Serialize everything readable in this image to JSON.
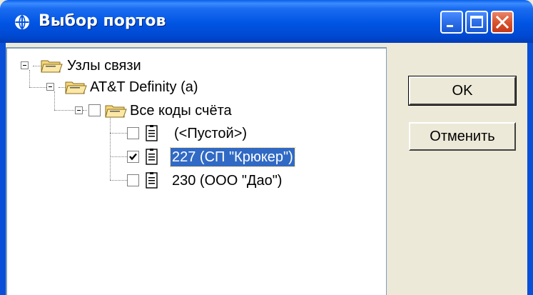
{
  "window": {
    "title": "Выбор портов"
  },
  "tree": {
    "root": {
      "label": "Узлы связи",
      "icon": "folder-open-icon",
      "expanded": true,
      "child": {
        "label": "AT&T Definity (a)",
        "icon": "folder-open-icon",
        "expanded": true,
        "child": {
          "label": "Все коды счёта",
          "icon": "folder-open-icon",
          "checked": false,
          "expanded": true,
          "items": [
            {
              "label": "(<Пустой>)",
              "checked": false,
              "selected": false,
              "icon": "document-icon"
            },
            {
              "label": "227 (СП \"Крюкер\")",
              "checked": true,
              "selected": true,
              "icon": "document-icon"
            },
            {
              "label": "230 (ООО \"Дао\")",
              "checked": false,
              "selected": false,
              "icon": "document-icon"
            }
          ]
        }
      }
    }
  },
  "buttons": {
    "ok_label": "OK",
    "cancel_label": "Отменить"
  },
  "colors": {
    "titlebar": "#0054e3",
    "selection": "#316ac5",
    "close_button": "#d9542f",
    "dialog_face": "#ece9d8"
  }
}
